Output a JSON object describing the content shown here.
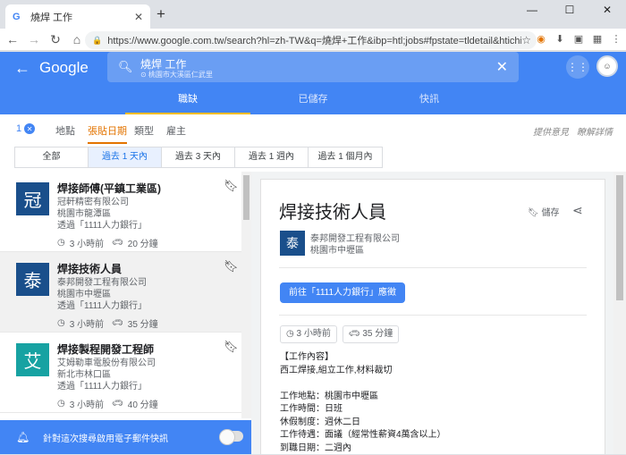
{
  "browser": {
    "tab_title": "燒焊 工作",
    "new_tab": "+",
    "url": "https://www.google.com.tw/search?hl=zh-TW&q=燒焊+工作&ibp=htl;jobs#fpstate=tldetail&htichips...",
    "win_min": "—",
    "win_max": "☐",
    "win_close": "✕",
    "tab_close": "✕",
    "fav_letter": "G"
  },
  "header": {
    "logo": "Google",
    "query": "燒焊 工作",
    "location": "⊙ 桃園市大溪區仁武里"
  },
  "tabs": [
    "職缺",
    "已儲存",
    "快訊"
  ],
  "filters": {
    "count": "1",
    "items": [
      "地點",
      "張貼日期",
      "類型",
      "雇主"
    ],
    "feedback": "提供意見",
    "learn_more": "瞭解詳情"
  },
  "date_options": [
    "全部",
    "過去 1 天內",
    "過去 3 天內",
    "過去 1 週內",
    "過去 1 個月內"
  ],
  "jobs": [
    {
      "title": "焊接師傅(平鎮工業區)",
      "company": "冠軒精密有限公司",
      "location": "桃園市龍潭區",
      "via": "透過「1111人力銀行」",
      "time": "3 小時前",
      "commute": "20 分鐘",
      "logo_char": "冠",
      "logo_color": "#1a4f8b"
    },
    {
      "title": "焊接技術人員",
      "company": "泰邦開發工程有限公司",
      "location": "桃園市中壢區",
      "via": "透過「1111人力銀行」",
      "time": "3 小時前",
      "commute": "35 分鐘",
      "logo_char": "泰",
      "logo_color": "#1a4f8b"
    },
    {
      "title": "焊接製程開發工程師",
      "company": "艾姆勒車電股份有限公司",
      "location": "新北市林口區",
      "via": "透過「1111人力銀行」",
      "time": "3 小時前",
      "commute": "40 分鐘",
      "logo_char": "艾",
      "logo_color": "#17a2a2"
    }
  ],
  "notify": {
    "text": "針對這次搜尋啟用電子郵件快訊"
  },
  "detail": {
    "title": "焊接技術人員",
    "save_label": "儲存",
    "company": "泰邦開發工程有限公司",
    "location": "桃園市中壢區",
    "logo_char": "泰",
    "apply": "前往「1111人力銀行」應徵",
    "time": "3 小時前",
    "commute": "35 分鐘",
    "description": "【工作內容】\n西工焊接,組立工作,材料裁切\n\n工作地點：桃園市中壢區\n工作時間：日班\n休假制度：週休二日\n工作待遇：面議（經常性薪資4萬含以上）\n到職日期：二週內"
  },
  "colors": {
    "brand": "#4285f4",
    "accent": "#e37400"
  }
}
